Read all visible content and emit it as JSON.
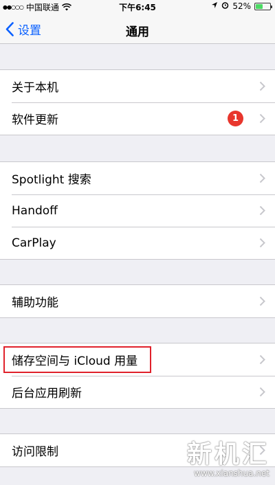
{
  "status_bar": {
    "signal": "●●○○○",
    "carrier": "中国联通",
    "time": "下午6:45",
    "battery_percent": "52%",
    "battery_level": 0.52,
    "icons": [
      "signal-icon",
      "wifi-icon",
      "location-icon",
      "alarm-icon",
      "battery-icon"
    ]
  },
  "nav": {
    "back_label": "设置",
    "title": "通用"
  },
  "groups": [
    {
      "rows": [
        {
          "label": "关于本机"
        },
        {
          "label": "软件更新",
          "badge": "1"
        }
      ]
    },
    {
      "rows": [
        {
          "label": "Spotlight 搜索"
        },
        {
          "label": "Handoff"
        },
        {
          "label": "CarPlay"
        }
      ]
    },
    {
      "rows": [
        {
          "label": "辅助功能"
        }
      ]
    },
    {
      "rows": [
        {
          "label": "储存空间与 iCloud 用量"
        },
        {
          "label": "后台应用刷新"
        }
      ]
    },
    {
      "rows": [
        {
          "label": "访问限制"
        }
      ]
    }
  ],
  "colors": {
    "accent": "#0a60ff",
    "badge": "#e8362d",
    "highlight": "#e0202a",
    "background": "#efeff4"
  },
  "watermark": {
    "logo": "新机汇",
    "url": "www.xianshua.net"
  }
}
